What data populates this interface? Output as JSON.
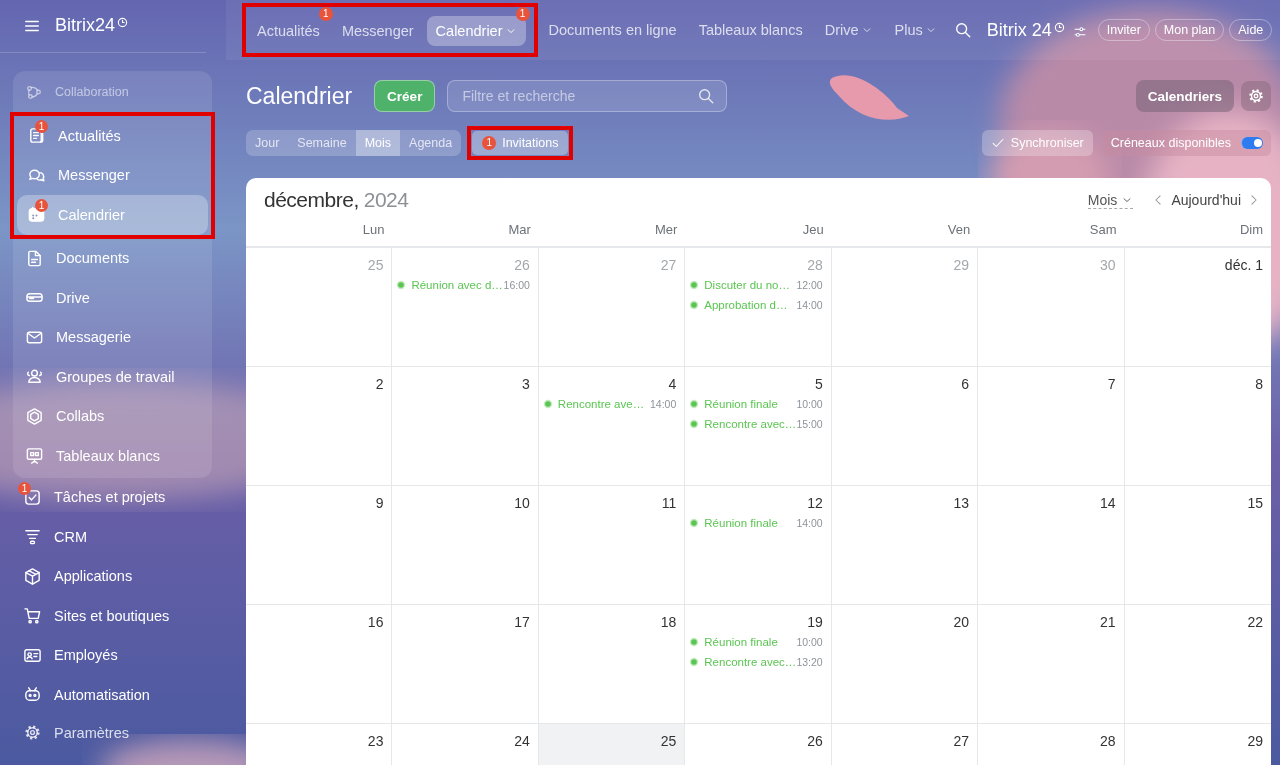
{
  "sidebar": {
    "logo": "Bitrix24",
    "group": {
      "title": "Collaboration",
      "sections": [
        {
          "highlighted": true,
          "items": [
            {
              "label": "Actualités",
              "badge": "1",
              "selected": false
            },
            {
              "label": "Messenger",
              "selected": false
            },
            {
              "label": "Calendrier",
              "badge": "1",
              "selected": true
            }
          ]
        },
        {
          "highlighted": false,
          "items": [
            {
              "label": "Documents",
              "selected": false
            },
            {
              "label": "Drive",
              "selected": false
            },
            {
              "label": "Messagerie",
              "selected": false
            },
            {
              "label": "Groupes de travail",
              "selected": false
            },
            {
              "label": "Collabs",
              "selected": false
            },
            {
              "label": "Tableaux blancs",
              "selected": false
            }
          ]
        }
      ]
    },
    "items": [
      {
        "label": "Tâches et projets",
        "badge": "1",
        "selected": false
      },
      {
        "label": "CRM",
        "selected": false
      },
      {
        "label": "Applications",
        "selected": false
      },
      {
        "label": "Sites et boutiques",
        "selected": false
      },
      {
        "label": "Employés",
        "selected": false
      },
      {
        "label": "Automatisation",
        "selected": false
      }
    ],
    "footer": {
      "label": "Paramètres"
    }
  },
  "top_nav": {
    "sections": [
      {
        "highlighted": true,
        "items": [
          {
            "label": "Actualités",
            "badge": "1",
            "selected": false,
            "dropdown": false
          },
          {
            "label": "Messenger",
            "selected": false,
            "dropdown": false
          },
          {
            "label": "Calendrier",
            "badge": "1",
            "selected": true,
            "dropdown": true
          }
        ]
      },
      {
        "highlighted": false,
        "items": [
          {
            "label": "Documents en ligne",
            "selected": false,
            "dropdown": false
          },
          {
            "label": "Tableaux blancs",
            "selected": false,
            "dropdown": false
          },
          {
            "label": "Drive",
            "selected": false,
            "dropdown": true
          },
          {
            "label": "Plus",
            "selected": false,
            "dropdown": true
          }
        ]
      }
    ],
    "logo": "Bitrix 24",
    "buttons": [
      "Inviter",
      "Mon plan",
      "Aide"
    ]
  },
  "toolbar": {
    "title": "Calendrier",
    "create": "Créer",
    "search": {
      "placeholder": "Filtre et recherche"
    },
    "views": [
      {
        "label": "Jour",
        "selected": false
      },
      {
        "label": "Semaine",
        "selected": false
      },
      {
        "label": "Mois",
        "selected": true
      },
      {
        "label": "Agenda",
        "selected": false
      }
    ],
    "invitations": {
      "label": "Invitations",
      "badge": "1",
      "highlighted": true
    },
    "calendars": "Calendriers",
    "sync": "Synchroniser",
    "slots": {
      "label": "Créneaux disponibles",
      "on": true
    }
  },
  "calendar": {
    "month": "décembre,",
    "year": "2024",
    "view": "Mois",
    "today": "Aujourd'hui",
    "weekdays": [
      "Lun",
      "Mar",
      "Mer",
      "Jeu",
      "Ven",
      "Sam",
      "Dim"
    ],
    "weeks": [
      [
        {
          "date": "25",
          "other_month": true
        },
        {
          "date": "26",
          "other_month": true,
          "events": [
            {
              "title": "Réunion avec d…",
              "time": "16:00"
            }
          ]
        },
        {
          "date": "27",
          "other_month": true
        },
        {
          "date": "28",
          "other_month": true,
          "events": [
            {
              "title": "Discuter du no…",
              "time": "12:00"
            },
            {
              "title": "Approbation d…",
              "time": "14:00"
            }
          ]
        },
        {
          "date": "29",
          "other_month": true
        },
        {
          "date": "30",
          "other_month": true
        },
        {
          "date": "déc. 1",
          "other_month": false
        }
      ],
      [
        {
          "date": "2",
          "other_month": false
        },
        {
          "date": "3",
          "other_month": false
        },
        {
          "date": "4",
          "other_month": false,
          "events": [
            {
              "title": "Rencontre ave…",
              "time": "14:00"
            }
          ]
        },
        {
          "date": "5",
          "other_month": false,
          "events": [
            {
              "title": "Réunion finale",
              "time": "10:00"
            },
            {
              "title": "Rencontre avec…",
              "time": "15:00"
            }
          ]
        },
        {
          "date": "6",
          "other_month": false
        },
        {
          "date": "7",
          "other_month": false
        },
        {
          "date": "8",
          "other_month": false
        }
      ],
      [
        {
          "date": "9",
          "other_month": false
        },
        {
          "date": "10",
          "other_month": false
        },
        {
          "date": "11",
          "other_month": false
        },
        {
          "date": "12",
          "other_month": false,
          "events": [
            {
              "title": "Réunion finale",
              "time": "14:00"
            }
          ]
        },
        {
          "date": "13",
          "other_month": false
        },
        {
          "date": "14",
          "other_month": false
        },
        {
          "date": "15",
          "other_month": false
        }
      ],
      [
        {
          "date": "16",
          "other_month": false
        },
        {
          "date": "17",
          "other_month": false
        },
        {
          "date": "18",
          "other_month": false
        },
        {
          "date": "19",
          "other_month": false,
          "events": [
            {
              "title": "Réunion finale",
              "time": "10:00"
            },
            {
              "title": "Rencontre avec…",
              "time": "13:20"
            }
          ]
        },
        {
          "date": "20",
          "other_month": false
        },
        {
          "date": "21",
          "other_month": false
        },
        {
          "date": "22",
          "other_month": false
        }
      ],
      [
        {
          "date": "23",
          "other_month": false
        },
        {
          "date": "24",
          "other_month": false
        },
        {
          "date": "25",
          "other_month": false,
          "shaded": true
        },
        {
          "date": "26",
          "other_month": false
        },
        {
          "date": "27",
          "other_month": false
        },
        {
          "date": "28",
          "other_month": false
        },
        {
          "date": "29",
          "other_month": false
        }
      ]
    ]
  }
}
